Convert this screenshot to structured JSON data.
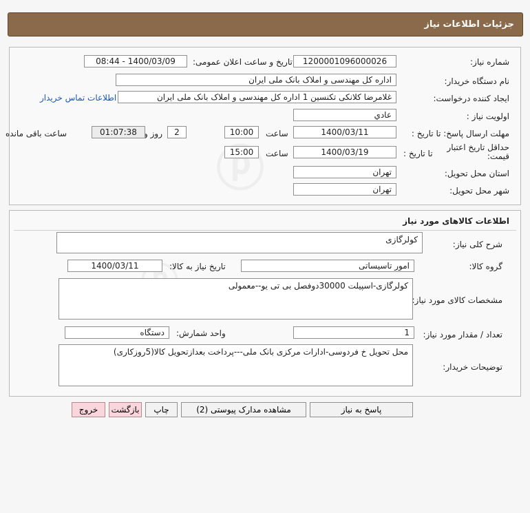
{
  "header": {
    "title": "جزئیات اطلاعات نیاز"
  },
  "details": {
    "need_number_label": "شماره نیاز:",
    "need_number": "1200001096000026",
    "announce_label": "تاریخ و ساعت اعلان عمومی:",
    "announce_value": "1400/03/09 - 08:44",
    "buyer_org_label": "نام دستگاه خریدار:",
    "buyer_org": "اداره کل مهندسی و املاک بانک ملی ایران",
    "requester_label": "ایجاد کننده درخواست:",
    "requester": "غلامرضا کلانکی تکنسین 1 اداره کل مهندسی و املاک بانک ملی ایران",
    "contact_link": "اطلاعات تماس خریدار",
    "priority_label": "اولویت نیاز :",
    "priority": "عادي",
    "deadline_label": "مهلت ارسال پاسخ: تا تاریخ :",
    "deadline_date": "1400/03/11",
    "time_label": "ساعت",
    "deadline_time": "10:00",
    "days_value": "2",
    "days_label": "روز و",
    "remaining_time": "01:07:38",
    "remaining_label": "ساعت باقی مانده",
    "validity_label": "حداقل تاریخ اعتبار قیمت:",
    "validity_until_label": "تا تاریخ :",
    "validity_date": "1400/03/19",
    "validity_time": "15:00",
    "province_label": "استان محل تحویل:",
    "province": "تهران",
    "city_label": "شهر محل تحویل:",
    "city": "تهران"
  },
  "goods": {
    "section_title": "اطلاعات کالاهای مورد نیاز",
    "summary_label": "شرح کلی نیاز:",
    "summary": "کولرگازی",
    "group_label": "گروه کالا:",
    "group": "امور تاسیساتی",
    "need_date_label": "تاریخ نیاز به کالا:",
    "need_date": "1400/03/11",
    "specs_label": "مشخصات کالای مورد نیاز:",
    "specs": "کولرگازی-اسپیلت 30000دوفصل بی تی یو--معمولی",
    "qty_label": "تعداد / مقدار مورد نیاز:",
    "qty": "1",
    "unit_label": "واحد شمارش:",
    "unit": "دستگاه",
    "notes_label": "توضیحات خریدار:",
    "notes": "محل تحویل خ فردوسی-ادارات مرکزی بانک ملی---پرداخت بعدازتحویل کالا(5روزکاری)"
  },
  "buttons": {
    "reply": "پاسخ به نیاز",
    "attachments": "مشاهده مدارک پیوستی (2)",
    "print": "چاپ",
    "back": "بازگشت",
    "exit": "خروج"
  }
}
